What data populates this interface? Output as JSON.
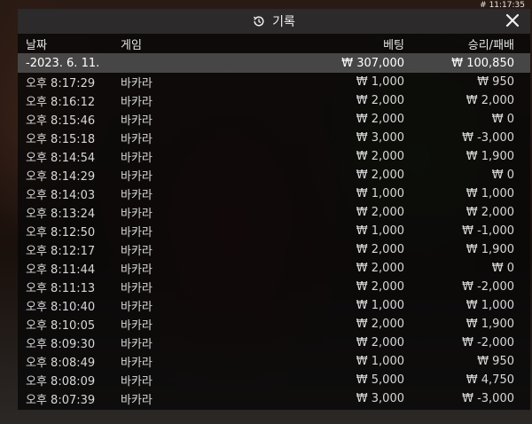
{
  "clock": "# 11:17:35",
  "header": {
    "title": "기록",
    "close_glyph": "✕"
  },
  "columns": {
    "date": "날짜",
    "game": "게임",
    "bet": "베팅",
    "result": "승리/패배"
  },
  "summary": {
    "date": "-2023. 6. 11.",
    "game": "",
    "bet": "₩ 307,000",
    "result": "₩ 100,850"
  },
  "rows": [
    {
      "time": "오후 8:17:29",
      "game": "바카라",
      "bet": "₩ 1,000",
      "result": "₩ 950"
    },
    {
      "time": "오후 8:16:12",
      "game": "바카라",
      "bet": "₩ 2,000",
      "result": "₩ 2,000"
    },
    {
      "time": "오후 8:15:46",
      "game": "바카라",
      "bet": "₩ 2,000",
      "result": "₩ 0"
    },
    {
      "time": "오후 8:15:18",
      "game": "바카라",
      "bet": "₩ 3,000",
      "result": "₩ -3,000"
    },
    {
      "time": "오후 8:14:54",
      "game": "바카라",
      "bet": "₩ 2,000",
      "result": "₩ 1,900"
    },
    {
      "time": "오후 8:14:29",
      "game": "바카라",
      "bet": "₩ 2,000",
      "result": "₩ 0"
    },
    {
      "time": "오후 8:14:03",
      "game": "바카라",
      "bet": "₩ 1,000",
      "result": "₩ 1,000"
    },
    {
      "time": "오후 8:13:24",
      "game": "바카라",
      "bet": "₩ 2,000",
      "result": "₩ 2,000"
    },
    {
      "time": "오후 8:12:50",
      "game": "바카라",
      "bet": "₩ 1,000",
      "result": "₩ -1,000"
    },
    {
      "time": "오후 8:12:17",
      "game": "바카라",
      "bet": "₩ 2,000",
      "result": "₩ 1,900"
    },
    {
      "time": "오후 8:11:44",
      "game": "바카라",
      "bet": "₩ 2,000",
      "result": "₩ 0"
    },
    {
      "time": "오후 8:11:13",
      "game": "바카라",
      "bet": "₩ 2,000",
      "result": "₩ -2,000"
    },
    {
      "time": "오후 8:10:40",
      "game": "바카라",
      "bet": "₩ 1,000",
      "result": "₩ 1,000"
    },
    {
      "time": "오후 8:10:05",
      "game": "바카라",
      "bet": "₩ 2,000",
      "result": "₩ 1,900"
    },
    {
      "time": "오후 8:09:30",
      "game": "바카라",
      "bet": "₩ 2,000",
      "result": "₩ -2,000"
    },
    {
      "time": "오후 8:08:49",
      "game": "바카라",
      "bet": "₩ 1,000",
      "result": "₩ 950"
    },
    {
      "time": "오후 8:08:09",
      "game": "바카라",
      "bet": "₩ 5,000",
      "result": "₩ 4,750"
    },
    {
      "time": "오후 8:07:39",
      "game": "바카라",
      "bet": "₩ 3,000",
      "result": "₩ -3,000"
    }
  ]
}
